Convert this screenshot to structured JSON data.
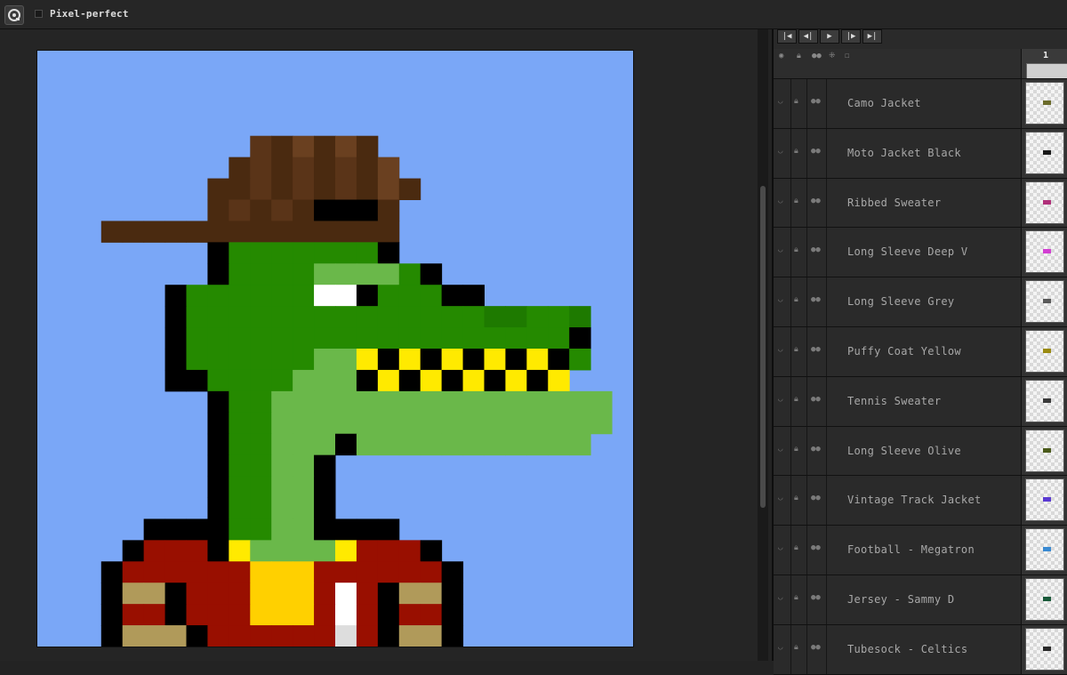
{
  "toolbar": {
    "pixel_perfect_label": "Pixel-perfect",
    "pixel_perfect_checked": false
  },
  "timeline": {
    "playback_buttons": [
      {
        "name": "first-frame-button",
        "icon": "first-frame-icon",
        "glyph": "|◀"
      },
      {
        "name": "previous-frame-button",
        "icon": "previous-frame-icon",
        "glyph": "◀|"
      },
      {
        "name": "play-button",
        "icon": "play-icon",
        "glyph": "▶"
      },
      {
        "name": "next-frame-button",
        "icon": "next-frame-icon",
        "glyph": "|▶"
      },
      {
        "name": "last-frame-button",
        "icon": "last-frame-icon",
        "glyph": "▶|"
      }
    ],
    "frame_number": "1",
    "layers": [
      {
        "label": "Camo Jacket",
        "swatch": "#6b6b2a"
      },
      {
        "label": "Moto Jacket Black",
        "swatch": "#1a1a1a"
      },
      {
        "label": "Ribbed Sweater",
        "swatch": "#b0307a"
      },
      {
        "label": "Long Sleeve Deep V",
        "swatch": "#d23fd2"
      },
      {
        "label": "Long Sleeve Grey",
        "swatch": "#5a5a5a"
      },
      {
        "label": "Puffy Coat Yellow",
        "swatch": "#9a8a10"
      },
      {
        "label": "Tennis Sweater",
        "swatch": "#3a3a3a"
      },
      {
        "label": "Long Sleeve Olive",
        "swatch": "#4a5a1a"
      },
      {
        "label": "Vintage Track Jacket",
        "swatch": "#5a3ad2"
      },
      {
        "label": "Football - Megatron",
        "swatch": "#3a8ad2"
      },
      {
        "label": "Jersey - Sammy D",
        "swatch": "#1a5a3a"
      },
      {
        "label": "Tubesock - Celtics",
        "swatch": "#2a2a2a"
      }
    ]
  },
  "canvas": {
    "background": "#7aa7f7",
    "palette": {
      "K": "#000000",
      "G": "#258a00",
      "g": "#1e7a00",
      "L": "#6ab84a",
      "M": "#5a9a40",
      "W": "#ffffff",
      "Y": "#ffea00",
      "y": "#ffd000",
      "B": "#4a2a10",
      "b": "#5a3418",
      "c": "#6a4020",
      "R": "#990f00",
      "r": "#7a0a00",
      "T": "#b09a5a",
      "S": "#dddddd"
    },
    "pixels": [
      "............................",
      "............................",
      "............................",
      "............................",
      "..........bBcBcB............",
      ".........BbBbBbBc...........",
      "........BBbBbBbBcB..........",
      "........BbBbBKKKB...........",
      "...BBBBBBBBBBBBBB...........",
      "........KGGGGGGGK...........",
      "........KGGGGLLLLGK.........",
      "......KGGGGGGWWKGGGKK.......",
      "......KGGGGGGGGGGGGGGggGGg..",
      "......KGGGGGGGGGGGGGGGGGGK..",
      "......KGGGGGGLLYKYKYKYKYKG..",
      "......KKGGGGLLLKYKYKYKYKY...",
      "........KGGLLLLLLLLLLLLLLLL.",
      "........KGGLLLLLLLLLLLLLLLL.",
      "........KGGLLLKLLLLLLLLLLL..",
      "........KGGLLK..............",
      "........KGGLLK..............",
      "........KGGLLK..............",
      ".....KKKKGGLLKKKK...........",
      "....KRRRKYLLLLYRRRK.........",
      "...KRRRRRRyyyRRRRRRK........",
      "...KTTKRRRyyyRWRKTTK........",
      "...KRRKRRRyyyRWRKRRK........",
      "...KTTTKRRRRRRSRKTTK........"
    ]
  }
}
